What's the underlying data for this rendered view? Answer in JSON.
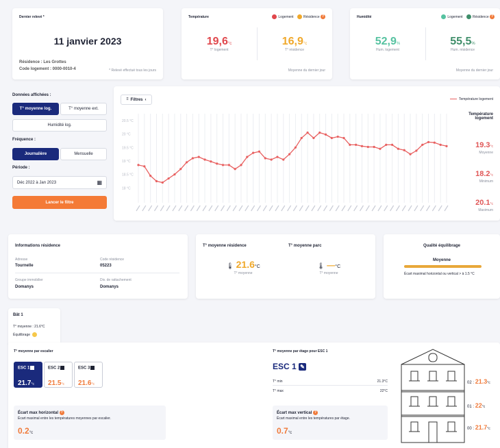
{
  "last_reading": {
    "title": "Dernier relevé *",
    "date": "11 janvier 2023",
    "residence": "Résidence : Les Grottes",
    "code": "Code logement : 0000-0010-4",
    "note": "* Relevé effectué tous les jours"
  },
  "temperature_card": {
    "title": "Température",
    "legend_logement": "Logement",
    "legend_residence": "Résidence",
    "val_log": "19,6",
    "val_res": "16,9",
    "unit": "°c",
    "lab_log": "T° logement",
    "lab_res": "T° résidence",
    "footer": "Moyenne du dernier jour",
    "color_log": "#e0474c",
    "color_res": "#f0a82a"
  },
  "humidity_card": {
    "title": "Humidité",
    "legend_logement": "Logement",
    "legend_residence": "Résidence",
    "val_log": "52,9",
    "val_res": "55,5",
    "unit": "%",
    "lab_log": "Hum. logement",
    "lab_res": "Hum. résidence",
    "footer": "Moyenne du dernier jour",
    "color_log": "#55c2a0",
    "color_res": "#3f8e6a"
  },
  "filters": {
    "donnees_label": "Données affichées :",
    "btn_tlog": "T° moyenne log.",
    "btn_text": "T° moyenne ext.",
    "btn_hum": "Humidité log.",
    "freq_label": "Fréquence :",
    "btn_day": "Journalière",
    "btn_month": "Mensuelle",
    "period_label": "Période :",
    "period_value": "Déc 2022 à Jan 2023",
    "launch": "Lancer le filtre"
  },
  "chart_panel": {
    "filters_btn": "Filtres",
    "legend": "Température logement",
    "side_title": "Température logement",
    "avg_val": "19.3",
    "avg_lab": "Moyenne",
    "min_val": "18.2",
    "min_lab": "Minimum",
    "max_val": "20.1",
    "max_lab": "Maximum",
    "unit": "°c"
  },
  "chart_data": {
    "type": "line",
    "ylim": [
      17.5,
      20.6
    ],
    "yticks": [
      "20.5 °C",
      "20 °C",
      "19.5 °C",
      "19 °C",
      "18.5 °C",
      "18 °C"
    ],
    "series": [
      {
        "name": "Température logement",
        "color": "#e86060",
        "values": [
          18.85,
          18.8,
          18.45,
          18.25,
          18.2,
          18.35,
          18.5,
          18.7,
          18.95,
          19.1,
          19.15,
          19.05,
          18.98,
          18.9,
          18.85,
          18.85,
          18.7,
          18.85,
          19.15,
          19.3,
          19.35,
          19.1,
          19.05,
          19.15,
          19.05,
          19.25,
          19.5,
          19.85,
          20.05,
          19.85,
          20.05,
          19.98,
          19.85,
          19.9,
          19.85,
          19.6,
          19.6,
          19.55,
          19.52,
          19.52,
          19.45,
          19.6,
          19.6,
          19.45,
          19.4,
          19.25,
          19.38,
          19.6,
          19.7,
          19.68,
          19.6,
          19.55
        ]
      }
    ]
  },
  "info_residence": {
    "title": "Informations résidence",
    "addr_lab": "Adresse",
    "addr_val": "Tournelle",
    "code_lab": "Code résidence",
    "code_val": "05223",
    "group_lab": "Groupe immobilier",
    "group_val": "Domanys",
    "div_lab": "Div. de rattachement",
    "div_val": "Domanys"
  },
  "avg_card": {
    "title_res": "T° moyenne résidence",
    "title_parc": "T° moyenne parc",
    "val_res": "21.6",
    "unit": "°C",
    "lab_res": "T° moyenne",
    "val_parc": "—",
    "lab_parc": "T° moyenne"
  },
  "quality": {
    "title": "Qualité équilibrage",
    "level": "Moyenne",
    "note": "Écart maximal horizontal ou vertical > à 1.5 °C",
    "bar_color": "#e8a83a"
  },
  "building_tab": {
    "title": "Bât 1",
    "avg": "T° moyenne : 21.6°C",
    "equilibrage": "Équilibrage"
  },
  "escaliers": {
    "title": "T° moyenne par escalier",
    "items": [
      {
        "name": "ESC 1",
        "val": "21.7",
        "unit": "°c"
      },
      {
        "name": "ESC 2",
        "val": "21.5",
        "unit": "°c"
      },
      {
        "name": "ESC 3",
        "val": "21.6",
        "unit": "°c"
      }
    ],
    "ecart_title": "Écart max horizontal",
    "ecart_desc": "Écart maximal entre les températures moyennes par escalier.",
    "ecart_val": "0.2",
    "ecart_unit": "°c"
  },
  "etages": {
    "title": "T° moyenne par étage pour ESC  1",
    "esc": "ESC 1",
    "tmin_lab": "T° min",
    "tmin_val": "21.3°C",
    "tmax_lab": "T° max",
    "tmax_val": "22°C",
    "ecart_title": "Écart max vertical",
    "ecart_desc": "Écart maximal entre les températures par étage.",
    "ecart_val": "0.7",
    "ecart_unit": "°c",
    "floors": [
      {
        "label": "02 :",
        "val": "21.3",
        "unit": "°c"
      },
      {
        "label": "01 :",
        "val": "22",
        "unit": "°c"
      },
      {
        "label": "00 :",
        "val": "21.7",
        "unit": "°c"
      }
    ]
  }
}
